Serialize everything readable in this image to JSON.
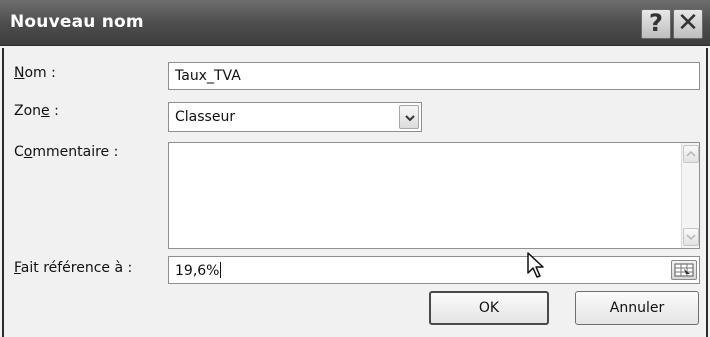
{
  "dialog": {
    "title": "Nouveau nom",
    "help_glyph": "?",
    "close_glyph": "✕"
  },
  "form": {
    "name": {
      "label_accel": "N",
      "label_rest": "om :",
      "value": "Taux_TVA"
    },
    "scope": {
      "label_pre": "Zon",
      "label_accel": "e",
      "label_rest": " :",
      "value": "Classeur"
    },
    "comment": {
      "label_pre": "C",
      "label_accel": "o",
      "label_rest": "mmentaire :",
      "value": ""
    },
    "refers_to": {
      "label_accel": "F",
      "label_rest": "ait référence à :",
      "value": "19,6%"
    }
  },
  "buttons": {
    "ok_label": "OK",
    "cancel_label": "Annuler"
  },
  "icons": {
    "combo_arrow": "chevron-down-icon",
    "scroll_up": "chevron-up-icon",
    "scroll_down": "chevron-down-icon",
    "range_picker": "range-select-icon",
    "mouse_pointer": "arrow-cursor-icon"
  },
  "colors": {
    "titlebar": "#4c4c4c",
    "title_text": "#ffffff",
    "dialog_bg": "#f1f1f1"
  }
}
